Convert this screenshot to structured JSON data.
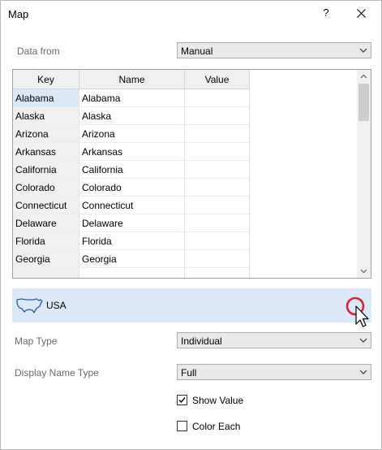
{
  "window": {
    "title": "Map",
    "help_label": "?"
  },
  "data_from": {
    "label": "Data from",
    "value": "Manual"
  },
  "grid": {
    "columns": [
      "Key",
      "Name",
      "Value"
    ],
    "rows": [
      {
        "key": "Alabama",
        "name": "Alabama",
        "value": ""
      },
      {
        "key": "Alaska",
        "name": "Alaska",
        "value": ""
      },
      {
        "key": "Arizona",
        "name": "Arizona",
        "value": ""
      },
      {
        "key": "Arkansas",
        "name": "Arkansas",
        "value": ""
      },
      {
        "key": "California",
        "name": "California",
        "value": ""
      },
      {
        "key": "Colorado",
        "name": "Colorado",
        "value": ""
      },
      {
        "key": "Connecticut",
        "name": "Connecticut",
        "value": ""
      },
      {
        "key": "Delaware",
        "name": "Delaware",
        "value": ""
      },
      {
        "key": "Florida",
        "name": "Florida",
        "value": ""
      },
      {
        "key": "Georgia",
        "name": "Georgia",
        "value": ""
      }
    ]
  },
  "map_selector": {
    "label": "USA",
    "icon": "usa-map-icon"
  },
  "map_type": {
    "label": "Map Type",
    "value": "Individual"
  },
  "display_name_type": {
    "label": "Display Name Type",
    "value": "Full"
  },
  "show_value": {
    "label": "Show Value",
    "checked": true
  },
  "color_each": {
    "label": "Color Each",
    "checked": false
  },
  "colors": {
    "selection": "#dbe8f8",
    "cursor_ring": "#e0202a"
  }
}
